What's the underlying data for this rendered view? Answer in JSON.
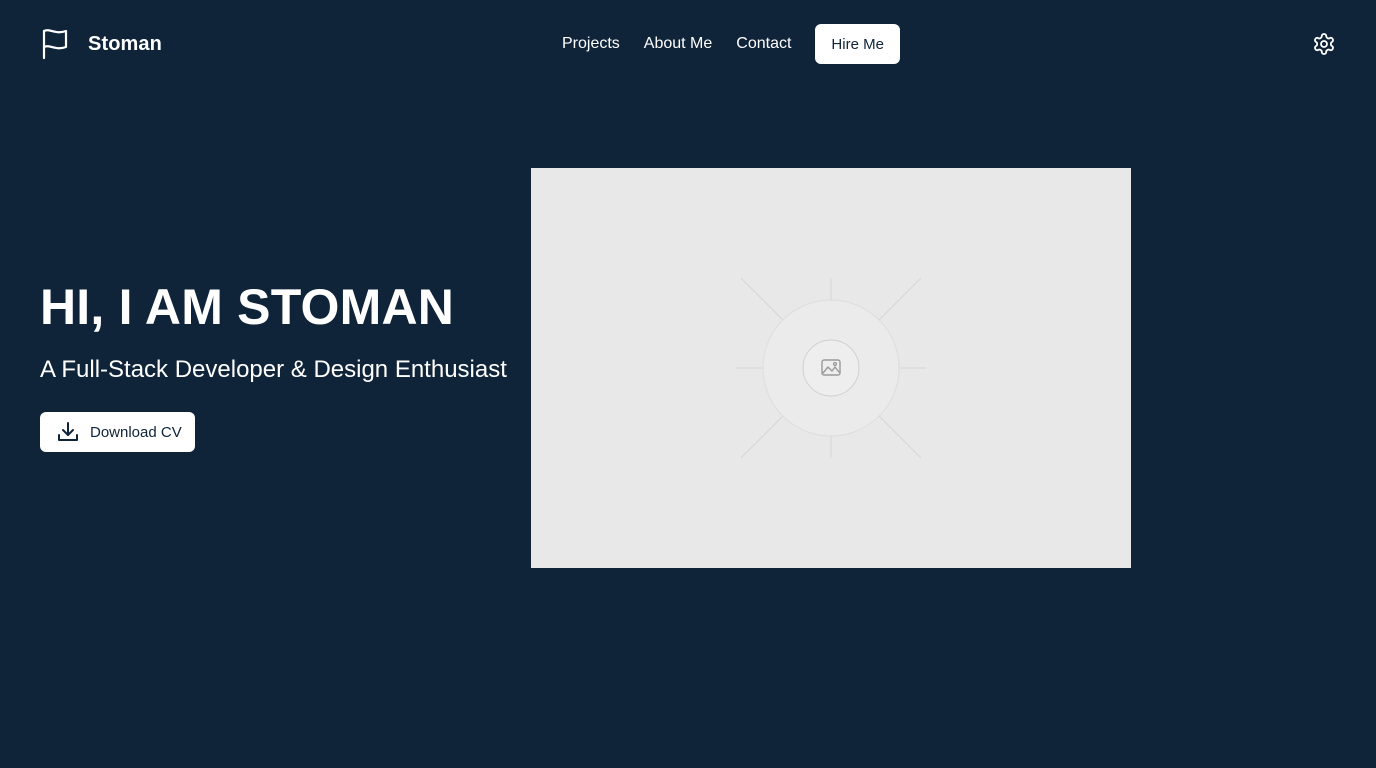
{
  "header": {
    "brand_icon": "flag-icon",
    "brand_name": "Stoman",
    "nav": [
      {
        "label": "Projects"
      },
      {
        "label": "About Me"
      },
      {
        "label": "Contact"
      }
    ],
    "hire_label": "Hire Me",
    "settings_icon": "gear-icon"
  },
  "hero": {
    "title": "HI, I AM STOMAN",
    "subtitle": "A Full-Stack Developer & Design Enthusiast",
    "cv_button": {
      "icon": "download-icon",
      "label": "Download CV"
    },
    "image_icon": "image-placeholder-icon"
  },
  "colors": {
    "background": "#0f2339",
    "text": "#ffffff",
    "button_bg": "#ffffff",
    "button_text": "#0f2339",
    "placeholder_bg": "#e8e8e8"
  }
}
